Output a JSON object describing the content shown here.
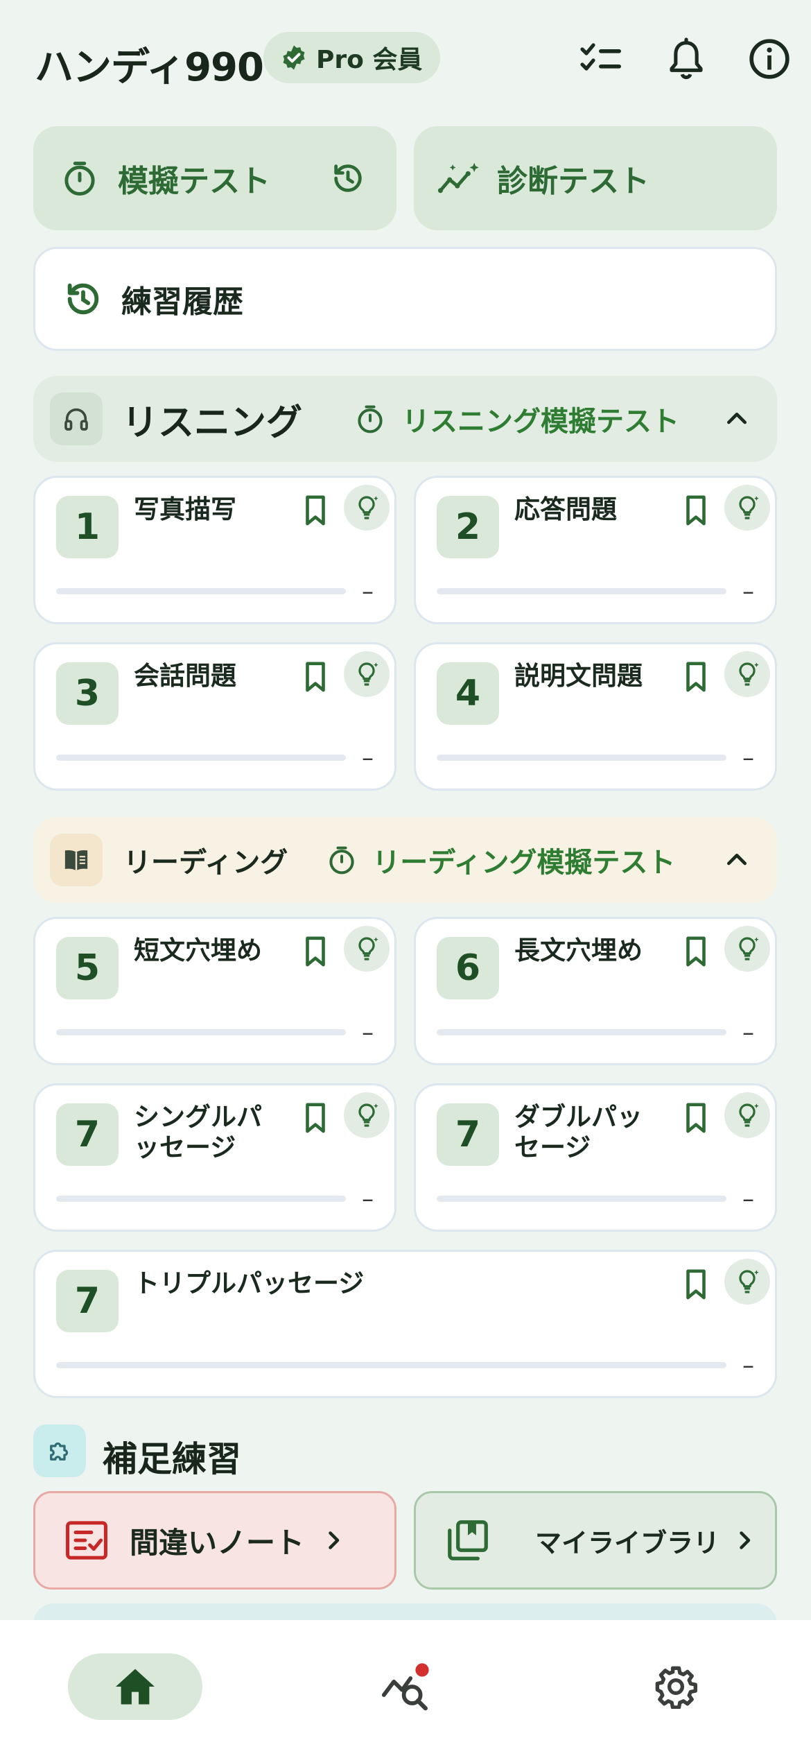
{
  "header": {
    "app_title": "ハンディ990",
    "pro_badge": "Pro 会員",
    "icons": [
      "checklist-icon",
      "bell-icon",
      "info-icon"
    ]
  },
  "top_actions": {
    "mock_test": "模擬テスト",
    "diagnostic_test": "診断テスト",
    "practice_history": "練習履歴"
  },
  "listening": {
    "title": "リスニング",
    "mock_test_link": "リスニング模擬テスト",
    "parts": [
      {
        "number": "1",
        "title": "写真描写",
        "progress": 0,
        "score": "–"
      },
      {
        "number": "2",
        "title": "応答問題",
        "progress": 0,
        "score": "–"
      },
      {
        "number": "3",
        "title": "会話問題",
        "progress": 0,
        "score": "–"
      },
      {
        "number": "4",
        "title": "説明文問題",
        "progress": 0,
        "score": "–"
      }
    ]
  },
  "reading": {
    "title": "リーディング",
    "mock_test_link": "リーディング模擬テスト",
    "parts": [
      {
        "number": "5",
        "title": "短文穴埋め",
        "progress": 0,
        "score": "–"
      },
      {
        "number": "6",
        "title": "長文穴埋め",
        "progress": 0,
        "score": "–"
      },
      {
        "number": "7",
        "title_line1": "シングルパ",
        "title_line2": "ッセージ",
        "progress": 0,
        "score": "–"
      },
      {
        "number": "7",
        "title_line1": "ダブルパッ",
        "title_line2": "セージ",
        "progress": 0,
        "score": "–"
      },
      {
        "number": "7",
        "title": "トリプルパッセージ",
        "progress": 0,
        "score": "–"
      }
    ]
  },
  "supplementary": {
    "title": "補足練習",
    "mistake_notes": "間違いノート",
    "my_library": "マイライブラリ"
  },
  "bottom_nav": {
    "items": [
      "home-icon",
      "analytics-icon",
      "settings-icon"
    ],
    "active": "home-icon",
    "analytics_has_badge": true
  },
  "colors": {
    "accent_green": "#2e6b34",
    "background": "#eef4ef",
    "reading_header_bg": "#f8f2e4",
    "mistake_bg": "#f8e4e2",
    "mistake_accent": "#c62828",
    "notification_dot": "#d32f2f"
  }
}
